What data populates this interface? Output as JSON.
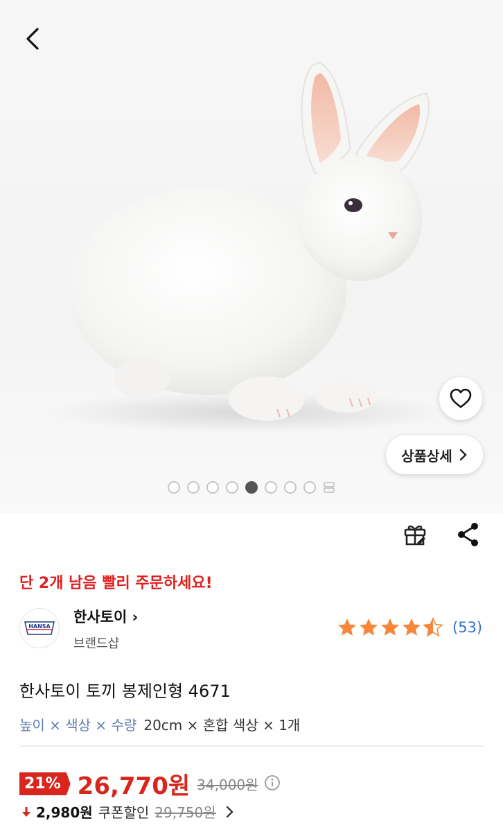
{
  "nav": {
    "back_icon": "chevron-left-icon"
  },
  "gallery": {
    "dot_count": 8,
    "active_index": 4,
    "wish_icon": "heart-outline-icon",
    "detail_label": "상품상세"
  },
  "actions": {
    "gift_icon": "gift-icon",
    "share_icon": "share-icon"
  },
  "stock_notice": "단 2개 남음 빨리 주문하세요!",
  "brand": {
    "name": "한사토이",
    "shop_label": "브랜드샵",
    "logo_text": "HANSA"
  },
  "rating": {
    "score": 4.5,
    "max": 5,
    "count": "(53)"
  },
  "product": {
    "title": "한사토이 토끼 봉제인형 4671",
    "option_labels": "높이 × 색상 × 수량",
    "option_values": "20cm × 혼합 색상 × 1개"
  },
  "price": {
    "discount": "21%",
    "sale": "26,770원",
    "original": "34,000원"
  },
  "coupon": {
    "amount": "2,980원",
    "label": "쿠폰할인",
    "price": "29,750원"
  },
  "colors": {
    "accent_red": "#d8261d",
    "star": "#f6873a",
    "link_blue": "#2d6fd6"
  }
}
